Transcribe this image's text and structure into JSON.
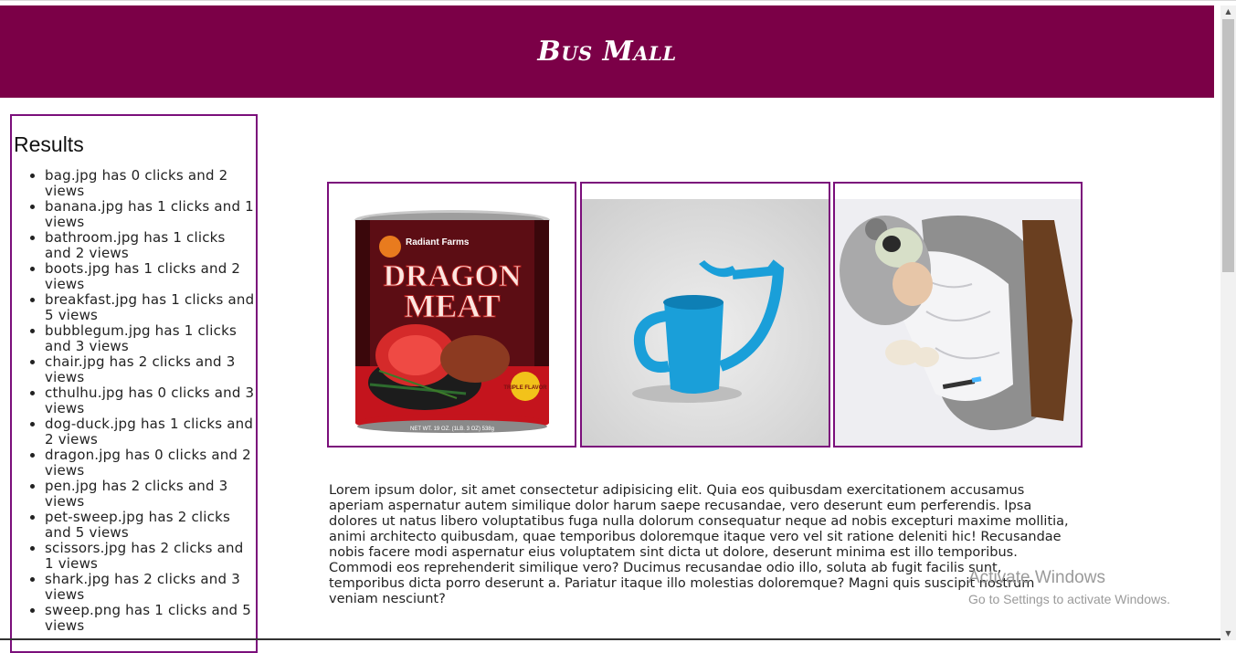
{
  "header": {
    "title": "Bus Mall"
  },
  "results": {
    "heading": "Results",
    "items": [
      "bag.jpg has 0 clicks and 2 views",
      "banana.jpg has 1 clicks and 1 views",
      "bathroom.jpg has 1 clicks and 2 views",
      "boots.jpg has 1 clicks and 2 views",
      "breakfast.jpg has 1 clicks and 5 views",
      "bubblegum.jpg has 1 clicks and 3 views",
      "chair.jpg has 2 clicks and 3 views",
      "cthulhu.jpg has 0 clicks and 3 views",
      "dog-duck.jpg has 1 clicks and 2 views",
      "dragon.jpg has 0 clicks and 2 views",
      "pen.jpg has 2 clicks and 3 views",
      "pet-sweep.jpg has 2 clicks and 5 views",
      "scissors.jpg has 2 clicks and 1 views",
      "shark.jpg has 2 clicks and 3 views",
      "sweep.png has 1 clicks and 5 views"
    ]
  },
  "products": {
    "left": {
      "brand": "Radiant Farms",
      "line1": "DRAGON",
      "line2": "MEAT",
      "badge": "TRIPLE FLAVOR",
      "net": "NET WT. 19 OZ. (1LB. 3 OZ) 538g"
    }
  },
  "body_text": "Lorem ipsum dolor, sit amet consectetur adipisicing elit. Quia eos quibusdam exercitationem accusamus aperiam aspernatur autem similique dolor harum saepe recusandae, vero deserunt eum perferendis. Ipsa dolores ut natus libero voluptatibus fuga nulla dolorum consequatur neque ad nobis excepturi maxime mollitia, animi architecto quibusdam, quae temporibus doloremque itaque vero vel sit ratione deleniti hic! Recusandae nobis facere modi aspernatur eius voluptatem sint dicta ut dolore, deserunt minima est illo temporibus. Commodi eos reprehenderit similique vero? Ducimus recusandae odio illo, soluta ab fugit facilis sunt, temporibus dicta porro deserunt a. Pariatur itaque illo molestias doloremque? Magni quis suscipit nostrum veniam nesciunt?",
  "watermark": {
    "line1": "Activate Windows",
    "line2": "Go to Settings to activate Windows."
  },
  "colors": {
    "header_bg": "#7b0047",
    "border": "#7b0f7b"
  },
  "icons": {
    "scroll_up": "scroll-up-arrow-icon",
    "scroll_down": "scroll-down-arrow-icon"
  }
}
